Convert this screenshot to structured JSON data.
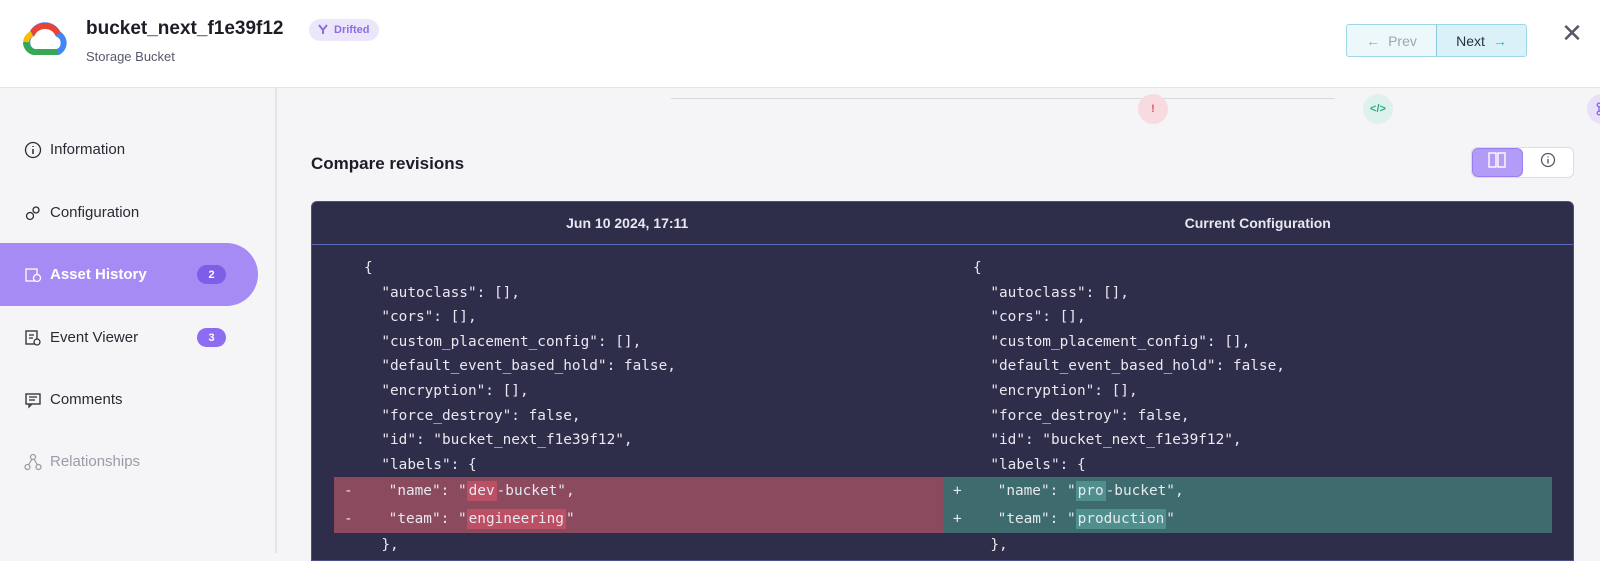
{
  "header": {
    "title": "bucket_next_f1e39f12",
    "badge": "Drifted",
    "subtitle": "Storage Bucket",
    "prev_label": "Prev",
    "next_label": "Next"
  },
  "sidebar": {
    "items": [
      {
        "label": "Information",
        "icon": "info-icon"
      },
      {
        "label": "Configuration",
        "icon": "gears-icon"
      },
      {
        "label": "Asset History",
        "icon": "history-icon",
        "count": "2",
        "active": true
      },
      {
        "label": "Event Viewer",
        "icon": "event-icon",
        "count": "3"
      },
      {
        "label": "Comments",
        "icon": "comment-icon"
      },
      {
        "label": "Relationships",
        "icon": "relationships-icon",
        "disabled": true
      }
    ]
  },
  "main": {
    "section_title": "Compare revisions",
    "diff": {
      "left_header": "Jun 10 2024, 17:11",
      "right_header": "Current Configuration",
      "common_lines": [
        "{",
        "  \"autoclass\": [],",
        "  \"cors\": [],",
        "  \"custom_placement_config\": [],",
        "  \"default_event_based_hold\": false,",
        "  \"encryption\": [],",
        "  \"force_destroy\": false,",
        "  \"id\": \"bucket_next_f1e39f12\",",
        "  \"labels\": {"
      ],
      "left_changes": [
        {
          "prefix": "    \"name\": \"",
          "highlight": "dev",
          "suffix": "-bucket\","
        },
        {
          "prefix": "    \"team\": \"",
          "highlight": "engineering",
          "suffix": "\""
        }
      ],
      "right_changes": [
        {
          "prefix": "    \"name\": \"",
          "highlight": "pro",
          "suffix": "-bucket\","
        },
        {
          "prefix": "    \"team\": \"",
          "highlight": "production",
          "suffix": "\""
        }
      ],
      "closing_line": "  },"
    }
  },
  "colors": {
    "accent": "#a78bf5",
    "diff_bg": "#2e2d4a",
    "deleted": "#8b4a5e",
    "added": "#3d6b6e",
    "drift_badge": "#8a6fe0"
  }
}
